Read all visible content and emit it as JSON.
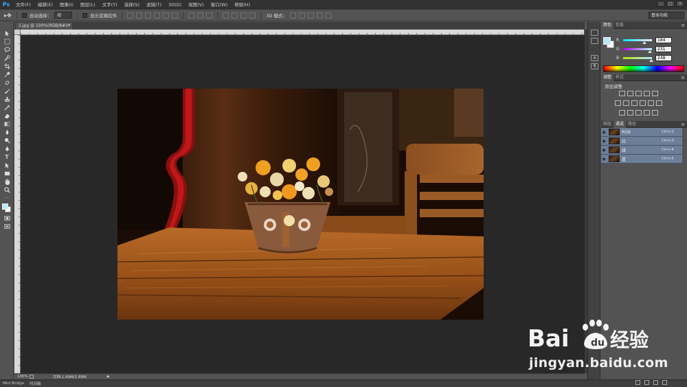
{
  "app": {
    "logo": "Ps"
  },
  "menu": [
    "文件(F)",
    "编辑(E)",
    "图像(I)",
    "图层(L)",
    "文字(Y)",
    "选择(S)",
    "滤镜(T)",
    "3D(D)",
    "视图(V)",
    "窗口(W)",
    "帮助(H)"
  ],
  "options_bar": {
    "auto_select_label": "自动选择：",
    "auto_select_value": "组",
    "show_transform_label": "显示变换控件",
    "mode_3d_label": "3D 模式："
  },
  "workspace": {
    "value": "基本功能"
  },
  "document": {
    "tab_title": "1.jpg @ 100%(RGB/8#) *",
    "close_glyph": "×"
  },
  "status": {
    "zoom": "100%",
    "doc_info": "文档:1.89M/1.89M",
    "arrow": "▶"
  },
  "bottom_tabs": [
    "Mini Bridge",
    "时间轴"
  ],
  "color_panel": {
    "tabs": [
      "颜色",
      "色板"
    ],
    "foreground_hex": "#b8e7f8",
    "background_hex": "#ffffff",
    "channels": [
      {
        "label": "R",
        "value": "184",
        "fraction": 0.72
      },
      {
        "label": "G",
        "value": "231",
        "fraction": 0.906
      },
      {
        "label": "B",
        "value": "248",
        "fraction": 0.973
      }
    ]
  },
  "adjust_panel": {
    "tabs": [
      "调整",
      "样式"
    ],
    "title": "添加调整"
  },
  "channels_panel": {
    "tabs": [
      "图层",
      "通道",
      "路径"
    ],
    "rows": [
      {
        "name": "RGB",
        "shortcut": "Ctrl+2"
      },
      {
        "name": "红",
        "shortcut": "Ctrl+3"
      },
      {
        "name": "绿",
        "shortcut": "Ctrl+4"
      },
      {
        "name": "蓝",
        "shortcut": "Ctrl+5"
      }
    ]
  },
  "watermark": {
    "brand": "Bai",
    "brand_tail": "经验",
    "url": "jingyan.baidu.com"
  }
}
